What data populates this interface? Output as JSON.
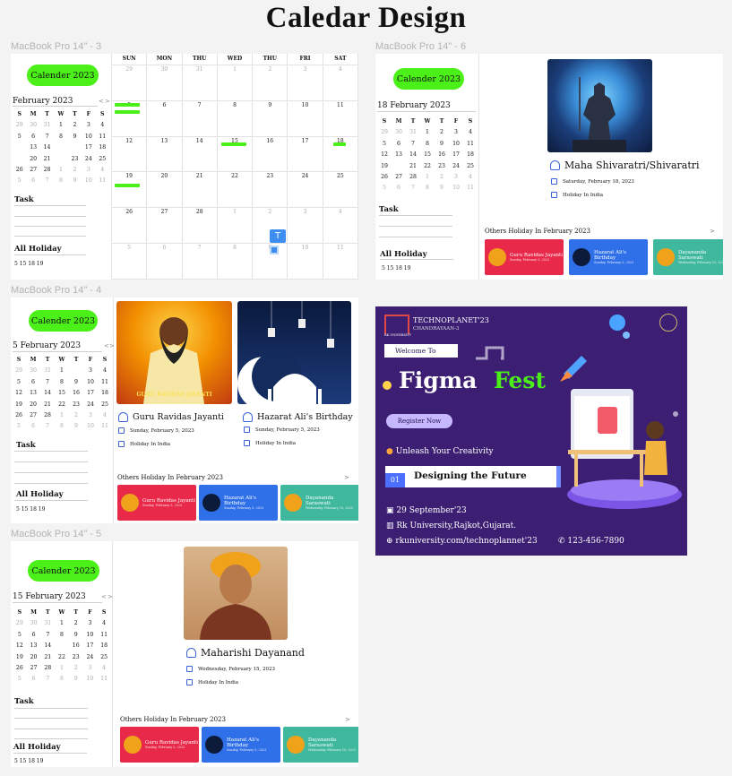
{
  "page_title": "Caledar Design",
  "frames": {
    "f3": "MacBook Pro 14\" - 3",
    "f6": "MacBook Pro 14\" - 6",
    "f4": "MacBook Pro 14\" - 4",
    "f5": "MacBook Pro 14\" - 5"
  },
  "sidebar": {
    "calendar_button": "Calender 2023",
    "nav_prev": "<",
    "nav_next": ">",
    "task_label": "Task",
    "holiday_label": "All Holiday",
    "holiday_dates": "5  15  18  19",
    "weekdays": [
      "S",
      "M",
      "T",
      "W",
      "T",
      "F",
      "S"
    ],
    "mini_days": [
      "29",
      "30",
      "31",
      "1",
      "2",
      "3",
      "4",
      "5",
      "6",
      "7",
      "8",
      "9",
      "10",
      "11",
      "12",
      "13",
      "14",
      "15",
      "16",
      "17",
      "18",
      "19",
      "20",
      "21",
      "22",
      "23",
      "24",
      "25",
      "26",
      "27",
      "28",
      "1",
      "2",
      "3",
      "4",
      "5",
      "6",
      "7",
      "8",
      "9",
      "10",
      "11"
    ]
  },
  "f3": {
    "month": "February 2023",
    "weekdays": [
      "SUN",
      "MON",
      "THU",
      "WED",
      "THU",
      "FRI",
      "SAT"
    ],
    "rows": [
      [
        "29",
        "30",
        "31",
        "1",
        "2",
        "3",
        "4"
      ],
      [
        "5",
        "6",
        "7",
        "8",
        "9",
        "10",
        "11"
      ],
      [
        "12",
        "13",
        "14",
        "15",
        "16",
        "17",
        "18"
      ],
      [
        "19",
        "20",
        "21",
        "22",
        "23",
        "24",
        "25"
      ],
      [
        "26",
        "27",
        "28",
        "1",
        "2",
        "3",
        "4"
      ],
      [
        "5",
        "6",
        "7",
        "8",
        "9",
        "10",
        "11"
      ]
    ],
    "text_tool": "T"
  },
  "f6": {
    "month": "18 February 2023",
    "holiday_name": "Maha Shivaratri/Shivaratri",
    "date_text": "Saturday, February 18, 2023",
    "place_text": "Holiday In India"
  },
  "f4": {
    "month": "5 February 2023",
    "holiday_a": "Guru Ravidas Jayanti",
    "date_a": "Sunday, February 5, 2023",
    "place_a": "Holiday In India",
    "banner_a": "GURU RAVIDAS JAYANTI",
    "holiday_b": "Hazarat Ali's Birthday",
    "date_b": "Sunday, February 5, 2023",
    "place_b": "Holiday In India"
  },
  "f5": {
    "month": "15 February 2023",
    "holiday_name": "Maharishi Dayanand",
    "date_text": "Wednesday, February 15, 2023",
    "place_text": "Holiday In India"
  },
  "others": {
    "heading": "Others Holiday In February 2023",
    "arrow": ">",
    "cards": [
      {
        "name": "Guru Ravidas Jayanti",
        "date": "Sunday, February 5, 2023",
        "color": "#e8294a"
      },
      {
        "name": "Hazarat Ali's Birthday",
        "date": "Sunday, February 5, 2023",
        "color": "#2f6fe8"
      },
      {
        "name": "Dayananda Saraswati",
        "date": "Wednesday, February 15, 2023",
        "color": "#3fb89e"
      }
    ]
  },
  "poster": {
    "org": "TECHNOPLANET'23",
    "sub": "CHANDRAYAAN-3",
    "logo_text": "RK UNIVERSITY",
    "welcome": "Welcome To",
    "figma": "Figma",
    "fest": "Fest",
    "register": "Register Now",
    "tagline": "Unleash Your Creativity",
    "num": "01",
    "designing": "Designing the Future",
    "date": "29 September'23",
    "venue": "Rk University,Rajkot,Gujarat.",
    "web": "rkuniversity.com/technoplannet'23",
    "phone": "123-456-7890"
  },
  "colors": {
    "accent_green": "#4cf019",
    "blue": "#3b62d9",
    "red_dot": "#e34747",
    "purple_dot": "#8f8ef0",
    "poster_bg": "#3c1f73"
  }
}
